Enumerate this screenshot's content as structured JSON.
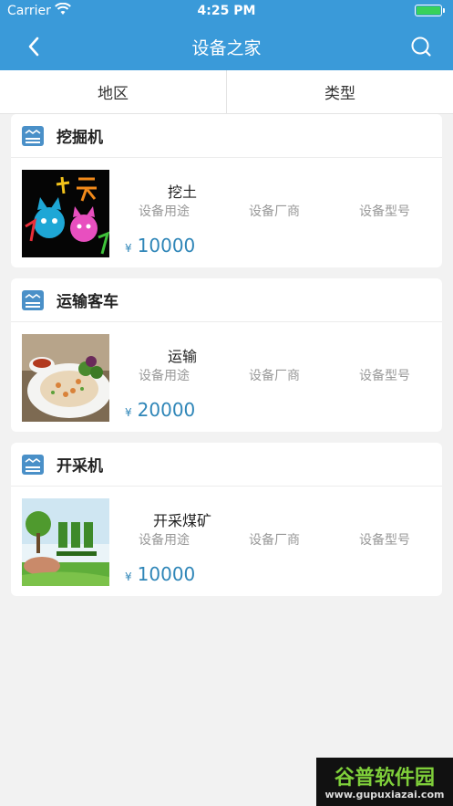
{
  "status_bar": {
    "carrier": "Carrier",
    "time": "4:25 PM"
  },
  "nav": {
    "title": "设备之家",
    "back_icon": "chevron-left-icon",
    "search_icon": "search-icon"
  },
  "filters": [
    {
      "label": "地区"
    },
    {
      "label": "类型"
    }
  ],
  "cards": [
    {
      "name": "挖掘机",
      "use": "挖土",
      "labels": [
        "设备用途",
        "设备厂商",
        "设备型号"
      ],
      "currency": "¥",
      "price": "10000"
    },
    {
      "name": "运输客车",
      "use": "运输",
      "labels": [
        "设备用途",
        "设备厂商",
        "设备型号"
      ],
      "currency": "¥",
      "price": "20000"
    },
    {
      "name": "开采机",
      "use": "开采煤矿",
      "labels": [
        "设备用途",
        "设备厂商",
        "设备型号"
      ],
      "currency": "¥",
      "price": "10000"
    }
  ],
  "watermark": {
    "main": "谷普软件园",
    "sub": "www.gupuxiazai.com"
  },
  "colors": {
    "nav": "#3a9ad9",
    "price": "#2f86b8",
    "background": "#f2f2f2"
  }
}
